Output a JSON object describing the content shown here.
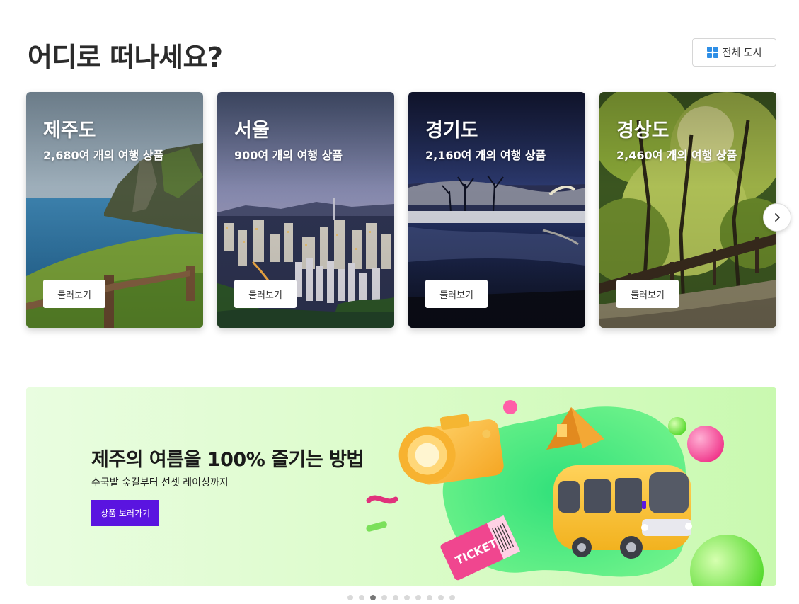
{
  "header": {
    "title": "어디로 떠나세요?",
    "all_cities_label": "전체 도시"
  },
  "destinations": [
    {
      "name": "제주도",
      "count": "2,680여 개의 여행 상품",
      "button": "둘러보기",
      "image": "coastal-cliff-photo"
    },
    {
      "name": "서울",
      "count": "900여 개의 여행 상품",
      "button": "둘러보기",
      "image": "city-skyline-photo"
    },
    {
      "name": "경기도",
      "count": "2,160여 개의 여행 상품",
      "button": "둘러보기",
      "image": "night-lake-photo"
    },
    {
      "name": "경상도",
      "count": "2,460여 개의 여행 상품",
      "button": "둘러보기",
      "image": "forest-trail-photo"
    }
  ],
  "carousel": {
    "next_icon": "chevron-right-icon"
  },
  "banner": {
    "title": "제주의 여름을 100% 즐기는 방법",
    "subtitle": "수국밭 숲길부터 선셋 레이싱까지",
    "button": "상품 보러가기",
    "ticket_text": "TICKET",
    "accent_color": "#5a14e0"
  },
  "pagination": {
    "total": 10,
    "active_index": 2
  }
}
